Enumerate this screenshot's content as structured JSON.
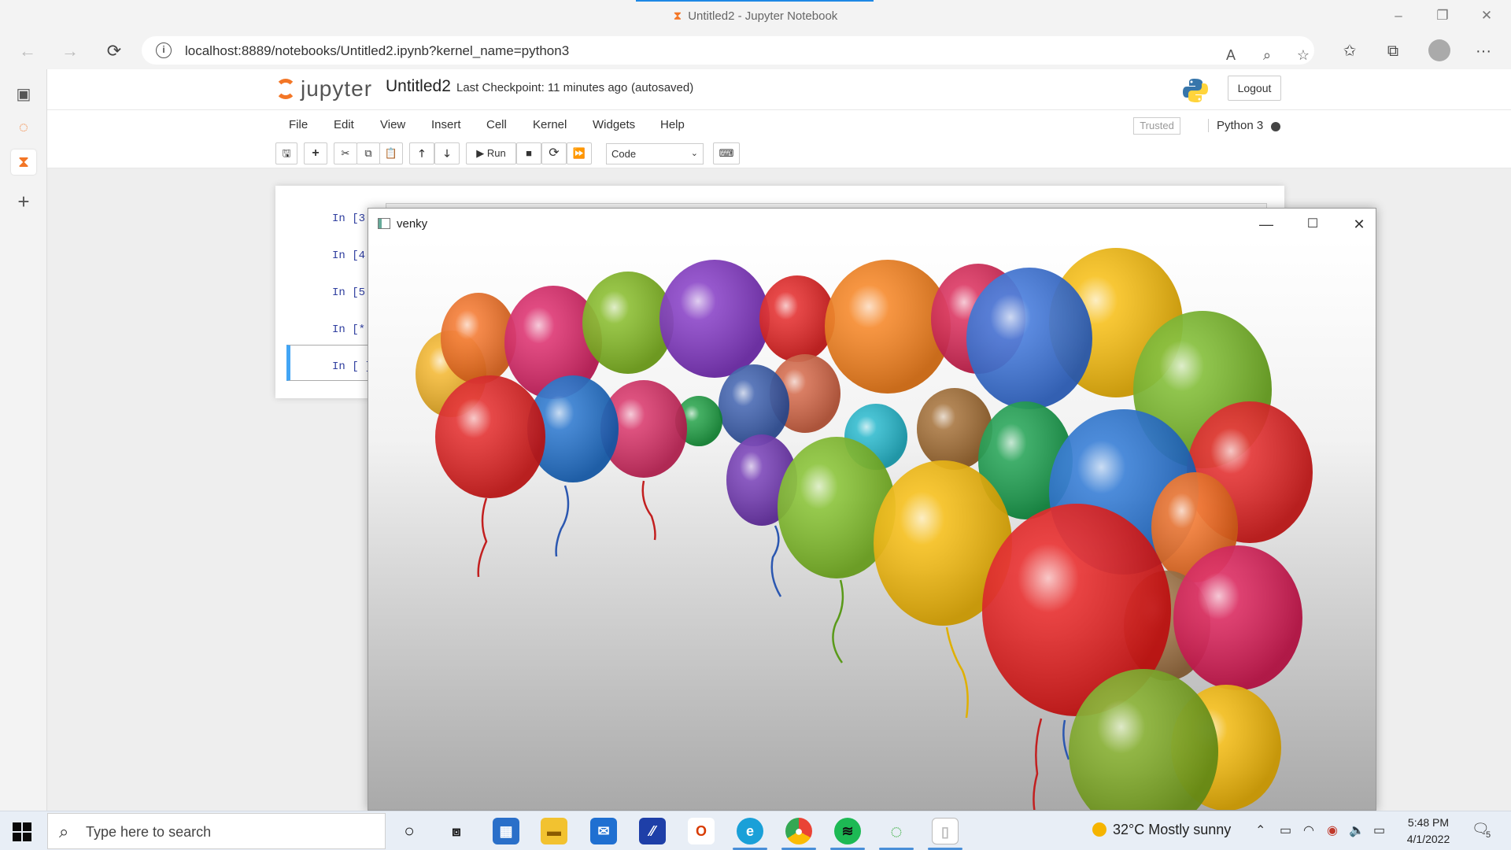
{
  "browser": {
    "window_title": "Untitled2 - Jupyter Notebook",
    "url": "localhost:8889/notebooks/Untitled2.ipynb?kernel_name=python3"
  },
  "notebook": {
    "logo_text": "jupyter",
    "name": "Untitled2",
    "checkpoint": "Last Checkpoint: 11 minutes ago",
    "autosave": "(autosaved)",
    "logout": "Logout",
    "menus": [
      "File",
      "Edit",
      "View",
      "Insert",
      "Cell",
      "Kernel",
      "Widgets",
      "Help"
    ],
    "trusted": "Trusted",
    "kernel": "Python 3",
    "toolbar": {
      "run_label": "Run",
      "cell_type": "Code"
    },
    "prompts": [
      "In [3",
      "In [4",
      "In [5",
      "In [*",
      "In [ ]"
    ]
  },
  "image_window": {
    "title": "venky"
  },
  "taskbar": {
    "search_placeholder": "Type here to search",
    "weather": "32°C  Mostly sunny",
    "time": "5:48 PM",
    "date": "4/1/2022",
    "notification_count": "5"
  },
  "colors": {
    "jupyter_orange": "#f37626",
    "prompt_blue": "#303f9f",
    "selected_cell_blue": "#42a5f5",
    "taskbar_bg": "#e8eef6"
  }
}
